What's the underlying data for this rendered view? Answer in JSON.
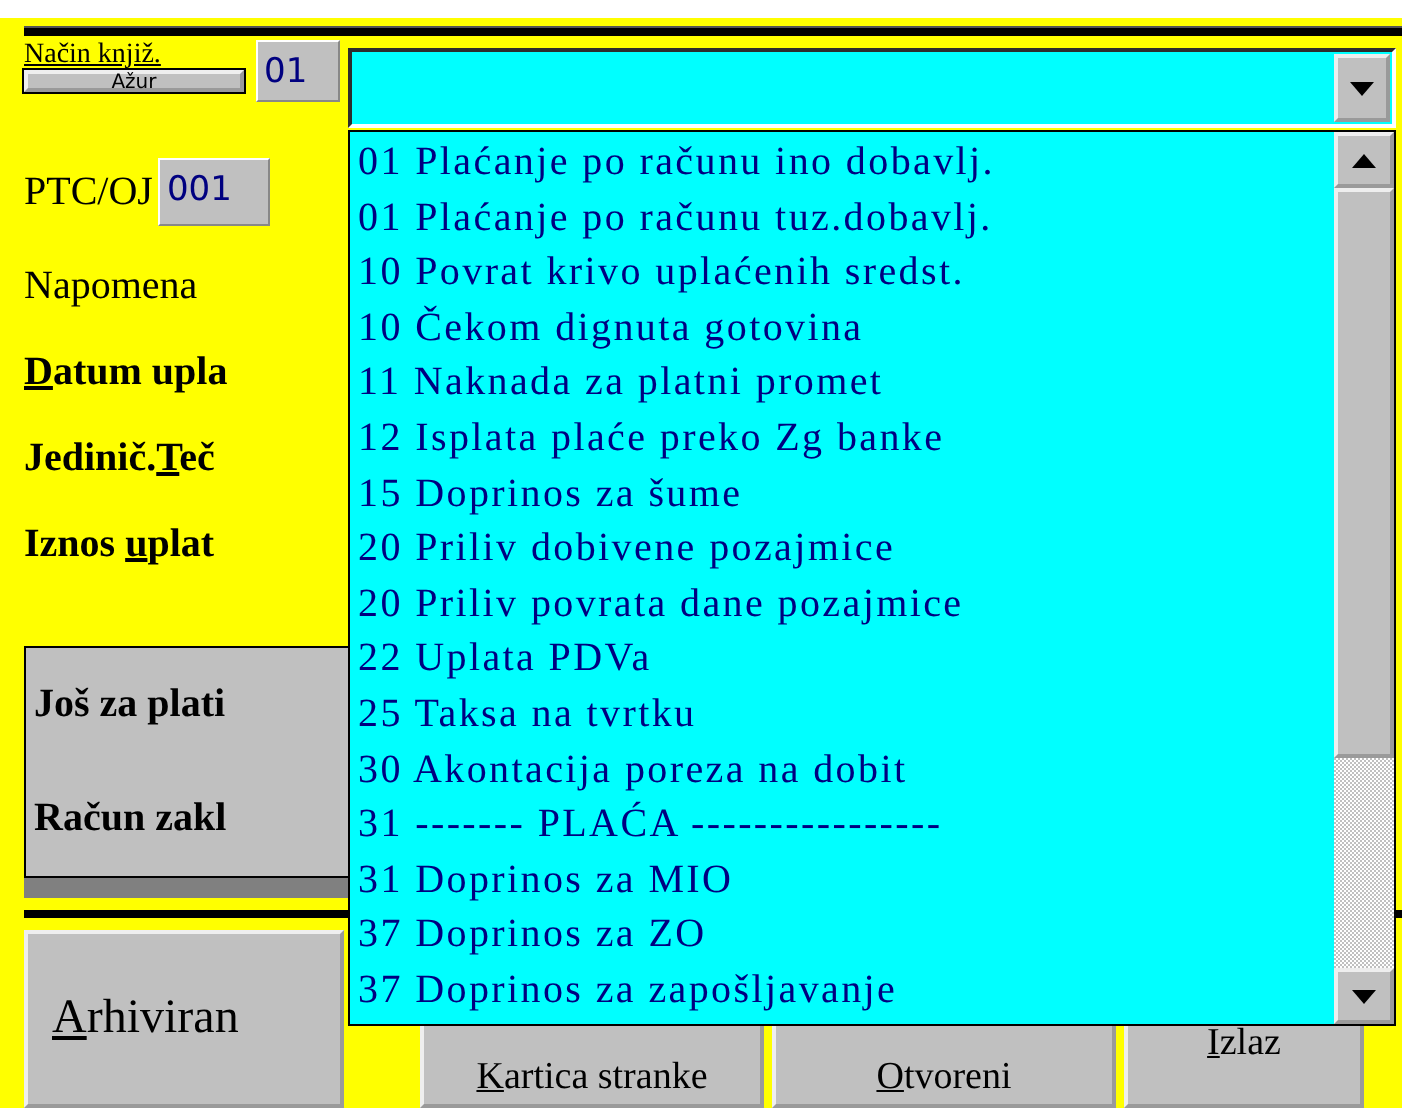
{
  "header": {
    "label": "Način knjiž.",
    "update_button": "Ažur",
    "value": "01"
  },
  "form_rows": [
    {
      "kind": "field",
      "label": {
        "pre": "PTC/OJ"
      },
      "value": "001"
    },
    {
      "kind": "plain",
      "label": {
        "pre": "Napomena"
      }
    },
    {
      "kind": "bold",
      "label": {
        "key": "D",
        "post": "atum upla"
      }
    },
    {
      "kind": "bold",
      "label": {
        "pre": "Jedinič.",
        "key": "T",
        "post": "eč"
      }
    },
    {
      "kind": "bold",
      "label": {
        "pre": "Iznos ",
        "key": "u",
        "post": "plat"
      }
    }
  ],
  "summary_rows": [
    {
      "label": "Još za plati"
    },
    {
      "label": "Račun zakl"
    }
  ],
  "buttons": [
    {
      "label": {
        "key": "A",
        "post": "rhiviran"
      }
    },
    {
      "label": {
        "key": "K",
        "post": "artica stranke"
      }
    },
    {
      "label": {
        "key": "O",
        "post": "tvoreni"
      }
    },
    {
      "label": {
        "key": "I",
        "post": "zlaz"
      }
    }
  ],
  "combo": {
    "expanded": true,
    "items": [
      {
        "label": "01 Plaćanje po računu ino dobavlj.",
        "selected": false
      },
      {
        "label": "01 Plaćanje po računu tuz.dobavlj.",
        "selected": false
      },
      {
        "label": "10 Povrat krivo uplaćenih sredst.",
        "selected": false
      },
      {
        "label": "10 Čekom dignuta gotovina",
        "selected": false
      },
      {
        "label": "11 Naknada za platni promet",
        "selected": false
      },
      {
        "label": "12 Isplata plaće preko Zg banke",
        "selected": false
      },
      {
        "label": "15 Doprinos za šume",
        "selected": false
      },
      {
        "label": "20 Priliv dobivene pozajmice",
        "selected": false
      },
      {
        "label": "20 Priliv povrata dane pozajmice",
        "selected": false
      },
      {
        "label": "22 Uplata PDVa",
        "selected": false
      },
      {
        "label": "25 Taksa na tvrtku",
        "selected": false
      },
      {
        "label": "30 Akontacija poreza na dobit",
        "selected": false
      },
      {
        "label": "31 ------- PLAĆA ----------------",
        "selected": false
      },
      {
        "label": "31 Doprinos za MIO",
        "selected": false
      },
      {
        "label": "37 Doprinos za ZO",
        "selected": false
      },
      {
        "label": "37 Doprinos za zapošljavanje",
        "selected": false
      }
    ]
  }
}
